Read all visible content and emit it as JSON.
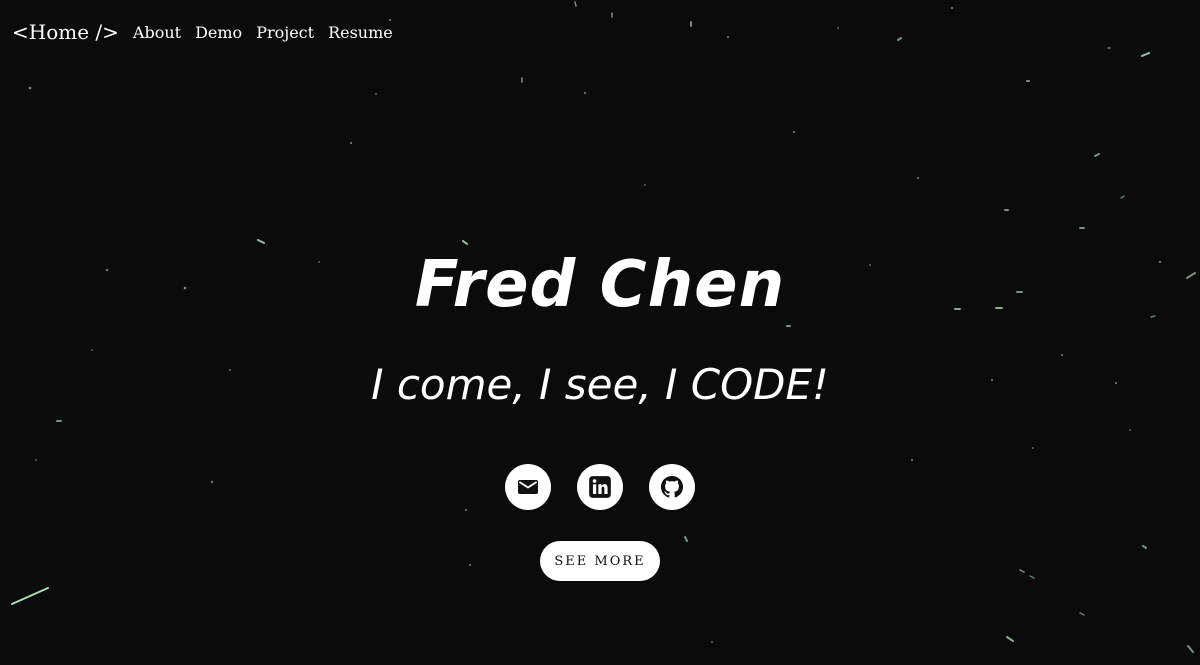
{
  "nav": {
    "brand": "<Home />",
    "links": [
      "About",
      "Demo",
      "Project",
      "Resume"
    ]
  },
  "hero": {
    "name": "Fred Chen",
    "tagline": "I come, I see, I CODE!"
  },
  "socials": [
    {
      "icon": "email-icon"
    },
    {
      "icon": "linkedin-icon"
    },
    {
      "icon": "github-icon"
    }
  ],
  "cta": {
    "label": "SEE MORE"
  },
  "colors": {
    "background": "#0b0b0b",
    "text": "#ffffff",
    "star": "#b8f5c8"
  }
}
